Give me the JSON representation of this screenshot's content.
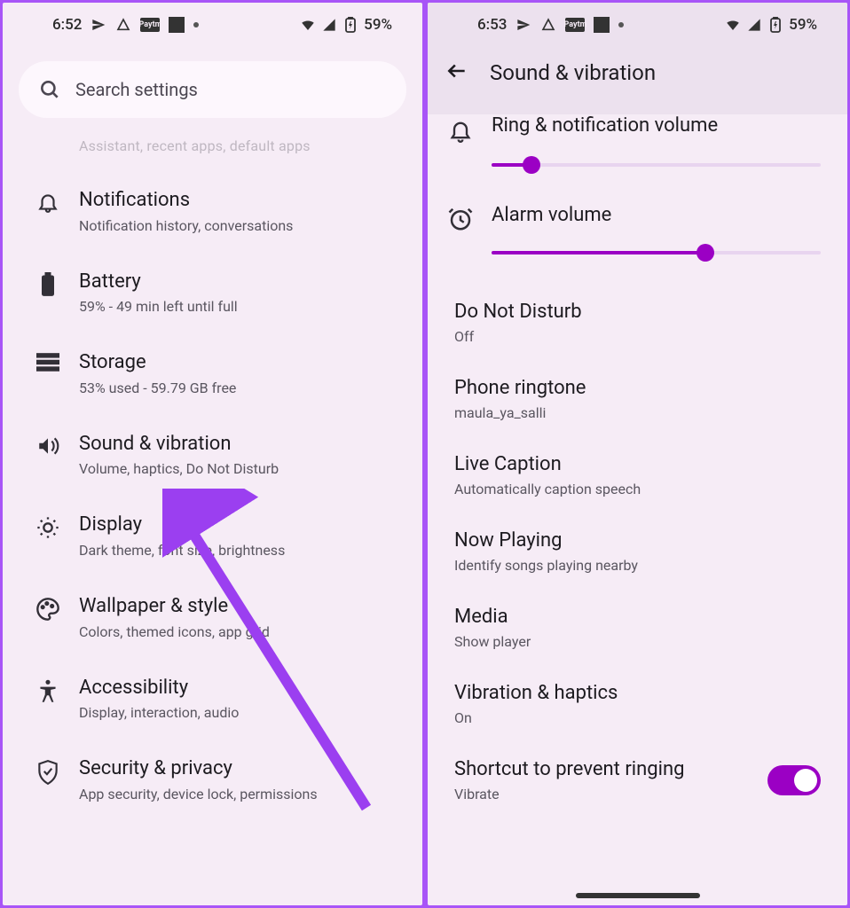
{
  "left": {
    "status": {
      "time": "6:52",
      "battery": "59%",
      "badge": "Paytm"
    },
    "search": {
      "placeholder": "Search settings"
    },
    "prev_sub": "Assistant, recent apps, default apps",
    "items": [
      {
        "title": "Notifications",
        "sub": "Notification history, conversations"
      },
      {
        "title": "Battery",
        "sub": "59% - 49 min left until full"
      },
      {
        "title": "Storage",
        "sub": "53% used - 59.79 GB free"
      },
      {
        "title": "Sound & vibration",
        "sub": "Volume, haptics, Do Not Disturb"
      },
      {
        "title": "Display",
        "sub": "Dark theme, font size, brightness"
      },
      {
        "title": "Wallpaper & style",
        "sub": "Colors, themed icons, app grid"
      },
      {
        "title": "Accessibility",
        "sub": "Display, interaction, audio"
      },
      {
        "title": "Security & privacy",
        "sub": "App security, device lock, permissions"
      }
    ]
  },
  "right": {
    "status": {
      "time": "6:53",
      "battery": "59%",
      "badge": "Paytm"
    },
    "header": "Sound & vibration",
    "sliders": [
      {
        "label": "Ring & notification volume",
        "value_pct": 12
      },
      {
        "label": "Alarm volume",
        "value_pct": 65
      }
    ],
    "prefs": [
      {
        "title": "Do Not Disturb",
        "sub": "Off"
      },
      {
        "title": "Phone ringtone",
        "sub": "maula_ya_salli"
      },
      {
        "title": "Live Caption",
        "sub": "Automatically caption speech"
      },
      {
        "title": "Now Playing",
        "sub": "Identify songs playing nearby"
      },
      {
        "title": "Media",
        "sub": "Show player"
      },
      {
        "title": "Vibration & haptics",
        "sub": "On"
      }
    ],
    "toggle_pref": {
      "title": "Shortcut to prevent ringing",
      "sub": "Vibrate",
      "on": true
    }
  }
}
